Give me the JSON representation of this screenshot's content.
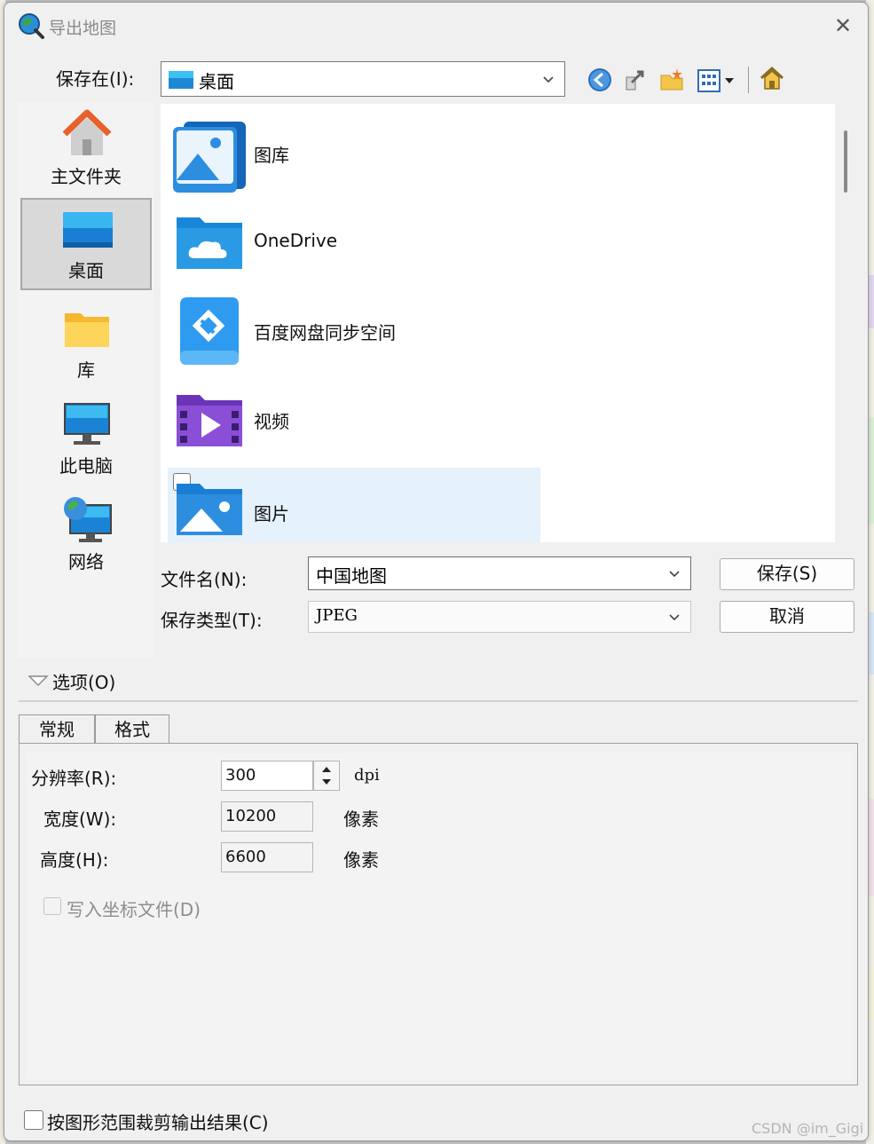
{
  "window": {
    "title": "导出地图",
    "close_glyph": "✕"
  },
  "location": {
    "label": "保存在(I):",
    "value": "桌面"
  },
  "toolbar": {
    "icons": [
      "back-icon",
      "up-folder-icon",
      "new-folder-icon",
      "view-menu-icon",
      "home-icon"
    ]
  },
  "places": [
    {
      "label": "主文件夹",
      "icon": "home-folder-icon",
      "selected": false
    },
    {
      "label": "桌面",
      "icon": "desktop-icon",
      "selected": true
    },
    {
      "label": "库",
      "icon": "library-folder-icon",
      "selected": false
    },
    {
      "label": "此电脑",
      "icon": "computer-icon",
      "selected": false
    },
    {
      "label": "网络",
      "icon": "network-icon",
      "selected": false
    }
  ],
  "files": [
    {
      "name": "图库",
      "icon": "gallery-icon"
    },
    {
      "name": "OneDrive",
      "icon": "onedrive-folder-icon"
    },
    {
      "name": "百度网盘同步空间",
      "icon": "baidu-netdisk-icon"
    },
    {
      "name": "视频",
      "icon": "videos-folder-icon"
    },
    {
      "name": "图片",
      "icon": "pictures-folder-icon"
    }
  ],
  "filename": {
    "label": "文件名(N):",
    "value": "中国地图"
  },
  "filetype": {
    "label": "保存类型(T):",
    "value": "JPEG"
  },
  "buttons": {
    "save": "保存(S)",
    "cancel": "取消"
  },
  "options": {
    "label": "选项(O)"
  },
  "tabs": [
    {
      "label": "常规",
      "active": true
    },
    {
      "label": "格式",
      "active": false
    }
  ],
  "settings": {
    "resolution": {
      "label": "分辨率(R):",
      "value": "300",
      "unit": "dpi"
    },
    "width": {
      "label": "宽度(W):",
      "value": "10200",
      "unit": "像素"
    },
    "height": {
      "label": "高度(H):",
      "value": "6600",
      "unit": "像素"
    },
    "world_file": {
      "label": "写入坐标文件(D)",
      "checked": false,
      "enabled": false
    }
  },
  "clip": {
    "label": "按图形范围裁剪输出结果(C)",
    "checked": false
  },
  "watermark": "CSDN @im_Gigi",
  "colors": {
    "selection": "#e5f1fb",
    "dialog_bg": "#f0f0f0",
    "accent_blue": "#1a7fd4"
  }
}
